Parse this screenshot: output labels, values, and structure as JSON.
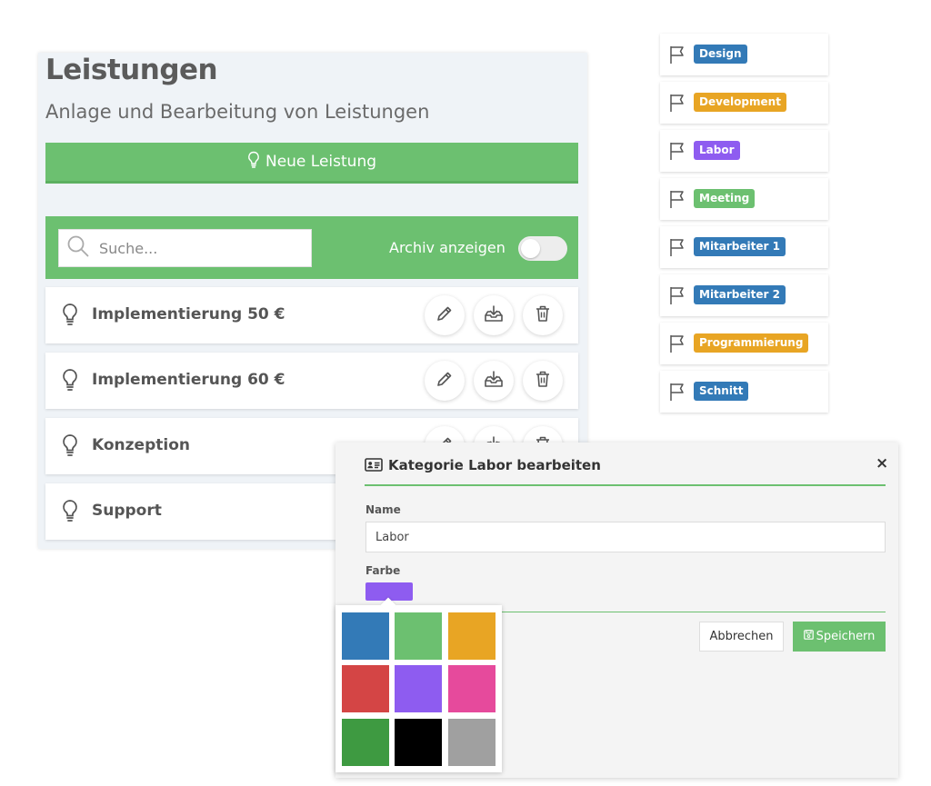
{
  "services_panel": {
    "title": "Leistungen",
    "subtitle": "Anlage und Bearbeitung von Leistungen",
    "new_button_label": "Neue Leistung",
    "search_placeholder": "Suche...",
    "archive_label": "Archiv anzeigen",
    "archive_toggle_on": false,
    "services": [
      {
        "name": "Implementierung 50 €"
      },
      {
        "name": "Implementierung 60 €"
      },
      {
        "name": "Konzeption"
      },
      {
        "name": "Support"
      }
    ]
  },
  "categories": [
    {
      "label": "Design",
      "color": "#337ab7"
    },
    {
      "label": "Development",
      "color": "#e8a524"
    },
    {
      "label": "Labor",
      "color": "#8e5cf0"
    },
    {
      "label": "Meeting",
      "color": "#6cc070"
    },
    {
      "label": "Mitarbeiter 1",
      "color": "#337ab7"
    },
    {
      "label": "Mitarbeiter 2",
      "color": "#337ab7"
    },
    {
      "label": "Programmierung",
      "color": "#e8a524"
    },
    {
      "label": "Schnitt",
      "color": "#337ab7"
    }
  ],
  "modal": {
    "title": "Kategorie Labor bearbeiten",
    "close_symbol": "×",
    "name_label": "Name",
    "name_value": "Labor",
    "color_label": "Farbe",
    "selected_color": "#8e5cf0",
    "cancel_label": "Abbrechen",
    "save_label": "Speichern"
  },
  "palette_colors": [
    "#337ab7",
    "#6cc070",
    "#e8a524",
    "#d44545",
    "#8e5cf0",
    "#e64a9c",
    "#3e9a41",
    "#000000",
    "#a0a0a0"
  ],
  "accent_color": "#6cc070"
}
